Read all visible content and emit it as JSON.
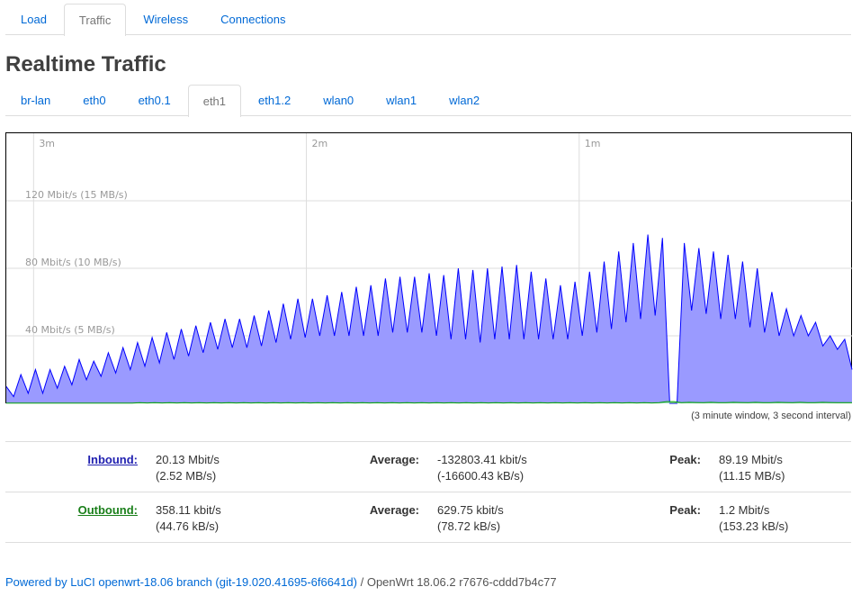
{
  "top_tabs": [
    {
      "label": "Load",
      "active": false
    },
    {
      "label": "Traffic",
      "active": true
    },
    {
      "label": "Wireless",
      "active": false
    },
    {
      "label": "Connections",
      "active": false
    }
  ],
  "page_title": "Realtime Traffic",
  "interface_tabs": [
    {
      "label": "br-lan",
      "active": false
    },
    {
      "label": "eth0",
      "active": false
    },
    {
      "label": "eth0.1",
      "active": false
    },
    {
      "label": "eth1",
      "active": true
    },
    {
      "label": "eth1.2",
      "active": false
    },
    {
      "label": "wlan0",
      "active": false
    },
    {
      "label": "wlan1",
      "active": false
    },
    {
      "label": "wlan2",
      "active": false
    }
  ],
  "chart_data": {
    "type": "area",
    "time_labels": [
      "3m",
      "2m",
      "1m"
    ],
    "y_labels": [
      "120 Mbit/s (15 MB/s)",
      "80 Mbit/s (10 MB/s)",
      "40 Mbit/s (5 MB/s)"
    ],
    "y_ticks": [
      120,
      80,
      40
    ],
    "ylim": [
      0,
      160
    ],
    "x_range_seconds": [
      -186,
      0
    ],
    "interval_seconds": 3,
    "grid": true,
    "series": [
      {
        "color": "#0000ff",
        "fill": "#9a9aff",
        "values": [
          10,
          4,
          17,
          6,
          20,
          6,
          20,
          9,
          22,
          11,
          26,
          14,
          25,
          16,
          30,
          18,
          33,
          20,
          36,
          22,
          39,
          24,
          42,
          26,
          44,
          28,
          46,
          30,
          48,
          32,
          50,
          33,
          50,
          33,
          52,
          34,
          55,
          36,
          59,
          38,
          62,
          39,
          62,
          40,
          64,
          40,
          66,
          40,
          69,
          40,
          70,
          40,
          74,
          42,
          75,
          42,
          75,
          42,
          77,
          40,
          76,
          38,
          80,
          38,
          79,
          36,
          80,
          38,
          81,
          38,
          82,
          38,
          78,
          38,
          74,
          38,
          70,
          38,
          72,
          40,
          78,
          42,
          84,
          44,
          90,
          48,
          95,
          50,
          100,
          52,
          98,
          0,
          0,
          95,
          55,
          92,
          53,
          90,
          50,
          88,
          50,
          84,
          45,
          80,
          42,
          66,
          40,
          56,
          40,
          52,
          40,
          48,
          34,
          40,
          32,
          38,
          20
        ]
      },
      {
        "color": "#00a000",
        "fill": "#9aff9a",
        "values": [
          0.1,
          0.1,
          0.1,
          0.1,
          0.1,
          0.1,
          0.1,
          0.1,
          0.1,
          0.1,
          0.1,
          0.1,
          0.1,
          0.1,
          0.1,
          0.1,
          0.1,
          0.1,
          0.4,
          0.2,
          0.4,
          0.2,
          0.4,
          0.2,
          0.4,
          0.2,
          0.4,
          0.2,
          0.4,
          0.2,
          0.4,
          0.2,
          0.4,
          0.2,
          0.4,
          0.2,
          0.4,
          0.2,
          0.4,
          0.2,
          0.4,
          0.2,
          0.4,
          0.2,
          0.4,
          0.2,
          0.4,
          0.2,
          0.4,
          0.2,
          0.4,
          0.2,
          0.4,
          0.2,
          0.4,
          0.2,
          0.4,
          0.2,
          0.4,
          0.2,
          0.4,
          0.2,
          0.4,
          0.2,
          0.4,
          0.2,
          0.4,
          0.2,
          0.4,
          0.2,
          0.4,
          0.2,
          0.4,
          0.2,
          0.4,
          0.2,
          0.4,
          0.2,
          0.4,
          0.2,
          0.4,
          0.2,
          0.4,
          0.2,
          0.4,
          0.2,
          0.4,
          0.2,
          0.4,
          1.0,
          1.0,
          0.4,
          0.6,
          0.5,
          0.4,
          0.6,
          0.4,
          0.4,
          0.6,
          0.5,
          0.4,
          0.6,
          0.4,
          0.4,
          0.6,
          0.5,
          0.4,
          0.6,
          0.4,
          0.4,
          0.6,
          0.5,
          0.4,
          0.4,
          0.4
        ]
      }
    ]
  },
  "caption": "(3 minute window, 3 second interval)",
  "inbound": {
    "label": "Inbound:",
    "current": "20.13 Mbit/s",
    "current_bytes": "(2.52 MB/s)",
    "avg_label": "Average:",
    "average": "-132803.41 kbit/s",
    "average_bytes": "(-16600.43 kB/s)",
    "peak_label": "Peak:",
    "peak": "89.19 Mbit/s",
    "peak_bytes": "(11.15 MB/s)"
  },
  "outbound": {
    "label": "Outbound:",
    "current": "358.11 kbit/s",
    "current_bytes": "(44.76 kB/s)",
    "avg_label": "Average:",
    "average": "629.75 kbit/s",
    "average_bytes": "(78.72 kB/s)",
    "peak_label": "Peak:",
    "peak": "1.2 Mbit/s",
    "peak_bytes": "(153.23 kB/s)"
  },
  "footer": {
    "link_text": "Powered by LuCI openwrt-18.06 branch (git-19.020.41695-6f6641d)",
    "separator": " / ",
    "version": "OpenWrt 18.06.2 r7676-cddd7b4c77"
  }
}
